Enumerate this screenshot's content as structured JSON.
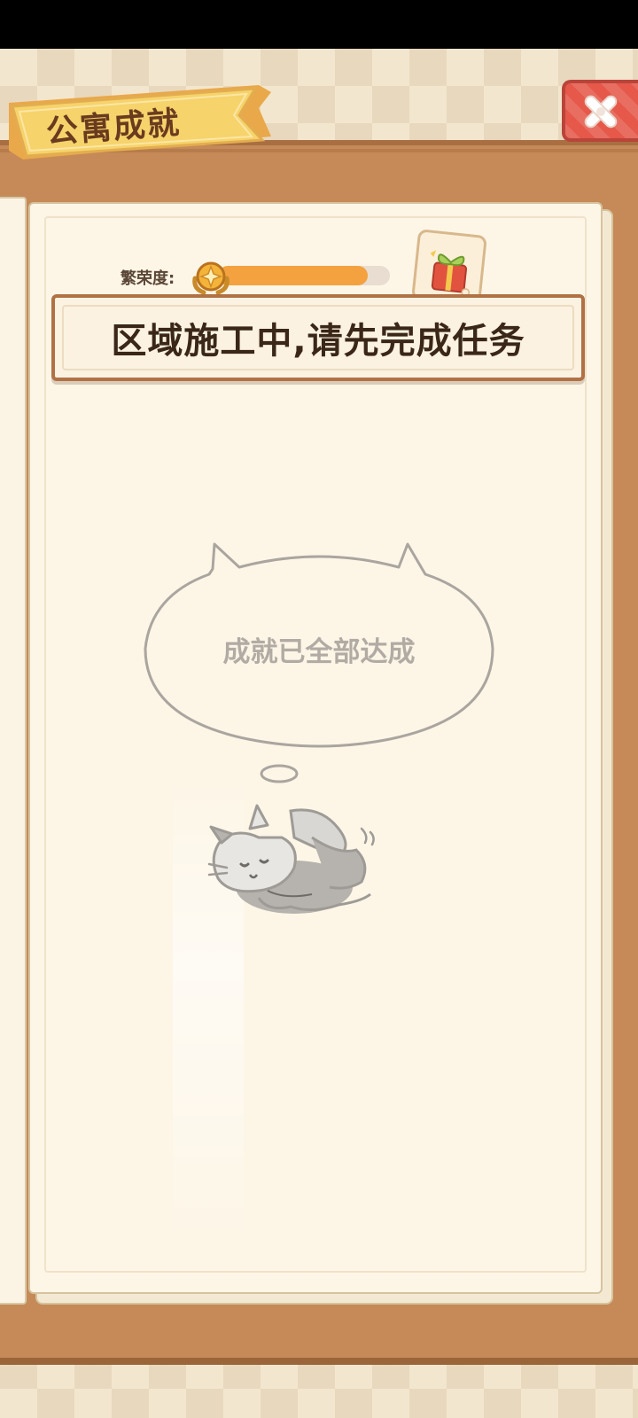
{
  "header": {
    "title": "公寓成就"
  },
  "close_button": {
    "icon": "close-icon"
  },
  "prosperity": {
    "label": "繁荣度:",
    "badge_icon": "laurel-badge-icon",
    "progress_fraction": 0.87,
    "reward_icon": "gift-box-icon"
  },
  "notice": {
    "text": "区域施工中,请先完成任务"
  },
  "empty_state": {
    "message": "成就已全部达成",
    "illustration": "sleeping-cat-icon"
  },
  "colors": {
    "progress_fill": "#f4a13f",
    "ribbon": "#f6d36b",
    "close_button": "#e5584a",
    "wood": "#c58a57"
  }
}
